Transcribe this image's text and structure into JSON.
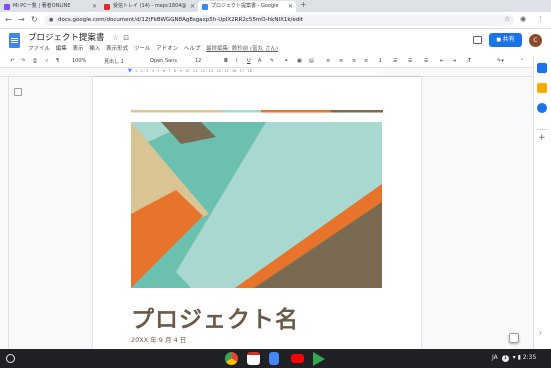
{
  "tabs": [
    {
      "title": "Mi PC一覧 | 著者ONLINE",
      "color": "#7c4dff"
    },
    {
      "title": "受信トレイ (14) - mepc1804@",
      "color": "#d93025"
    },
    {
      "title": "プロジェクト提案書 - Google",
      "color": "#4285f4"
    }
  ],
  "new_tab": "+",
  "url": "docs.google.com/document/d/12tFkBWGGN8Ag8sgaxp5h-UpIX2RR2c55mO-hkNIX1k/edit",
  "doc_title": "プロジェクト提案書",
  "menu": [
    "ファイル",
    "編集",
    "表示",
    "挿入",
    "表示形式",
    "ツール",
    "アドオン",
    "ヘルプ"
  ],
  "last_edit": "最終編集: 数秒前 (富丸 さん)",
  "share_label": "共有",
  "avatar_initial": "C",
  "toolbar": {
    "zoom": "100%",
    "style": "見出し 1",
    "font": "Open Sans",
    "size": "12",
    "bold": "B",
    "italic": "I",
    "underline": "U",
    "textcolor": "A"
  },
  "ruler_numbers": "1 · 2 · 3 · 4 · 5 · 6 · 7 · 8 · 9 · 10 · 11 · 12 · 13 · 14 · 15 · 16 · 17 · 18",
  "doc_heading": "プロジェクト名",
  "doc_date": "20XX 年 9 月 4 日",
  "tray": {
    "ime": "JA",
    "notifications": "1",
    "time": "2:35"
  },
  "colors": {
    "teal": "#6cc0b0",
    "light_teal": "#a8d8d0",
    "tan": "#d9c594",
    "brown": "#7a6a52",
    "orange": "#e8732a",
    "heading": "#6b5a46"
  }
}
